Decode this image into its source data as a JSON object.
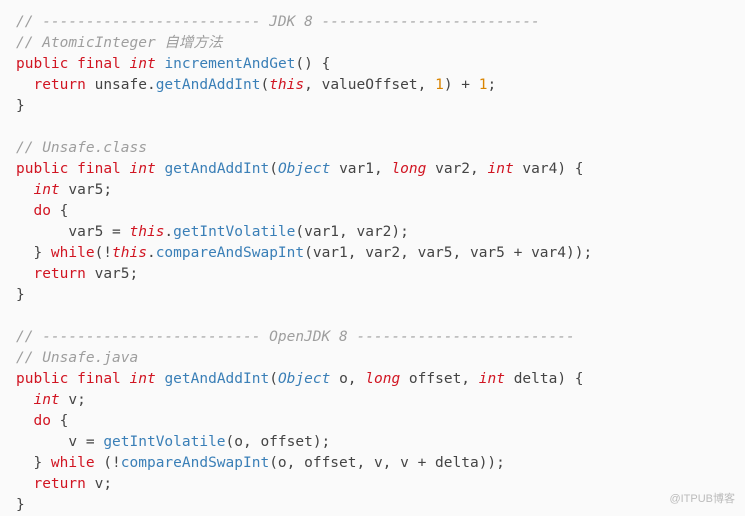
{
  "code": {
    "l1_comment": "// ------------------------- JDK 8 -------------------------",
    "l2_comment": "// AtomicInteger 自增方法",
    "l3": {
      "kw1": "public",
      "kw2": "final",
      "type": "int",
      "fn": "incrementAndGet",
      "rest": "() {"
    },
    "l4": {
      "kw": "return",
      "obj": " unsafe.",
      "fn": "getAndAddInt",
      "open": "(",
      "this": "this",
      "mid": ", valueOffset, ",
      "num1": "1",
      "between": ") + ",
      "num2": "1",
      "end": ";"
    },
    "l5": "}",
    "blank1": "",
    "l6_comment": "// Unsafe.class",
    "l7": {
      "kw1": "public",
      "kw2": "final",
      "type": "int",
      "fn": "getAndAddInt",
      "open": "(",
      "ptype1": "Object",
      "p1": " var1, ",
      "ptype2": "long",
      "p2": " var2, ",
      "ptype3": "int",
      "p3": " var4) {"
    },
    "l8": {
      "type": "int",
      "rest": " var5;"
    },
    "l9": {
      "kw": "do",
      "rest": " {"
    },
    "l10": {
      "lhs": "      var5 = ",
      "this": "this",
      "dot": ".",
      "fn": "getIntVolatile",
      "rest": "(var1, var2);"
    },
    "l11": {
      "close": "  } ",
      "while": "while",
      "open": "(!",
      "this": "this",
      "dot": ".",
      "fn": "compareAndSwapInt",
      "rest": "(var1, var2, var5, var5 + var4));"
    },
    "l12": {
      "kw": "return",
      "rest": " var5;"
    },
    "l13": "}",
    "blank2": "",
    "l14_comment": "// ------------------------- OpenJDK 8 -------------------------",
    "l15_comment": "// Unsafe.java",
    "l16": {
      "kw1": "public",
      "kw2": "final",
      "type": "int",
      "fn": "getAndAddInt",
      "open": "(",
      "ptype1": "Object",
      "p1": " o, ",
      "ptype2": "long",
      "p2": " offset, ",
      "ptype3": "int",
      "p3": " delta) {"
    },
    "l17": {
      "type": "int",
      "rest": " v;"
    },
    "l18": {
      "kw": "do",
      "rest": " {"
    },
    "l19": {
      "lhs": "      v = ",
      "fn": "getIntVolatile",
      "rest": "(o, offset);"
    },
    "l20": {
      "close": "  } ",
      "while": "while",
      "open": " (!",
      "fn": "compareAndSwapInt",
      "rest": "(o, offset, v, v + delta));"
    },
    "l21": {
      "kw": "return",
      "rest": " v;"
    },
    "l22": "}"
  },
  "watermark": "@ITPUB博客"
}
